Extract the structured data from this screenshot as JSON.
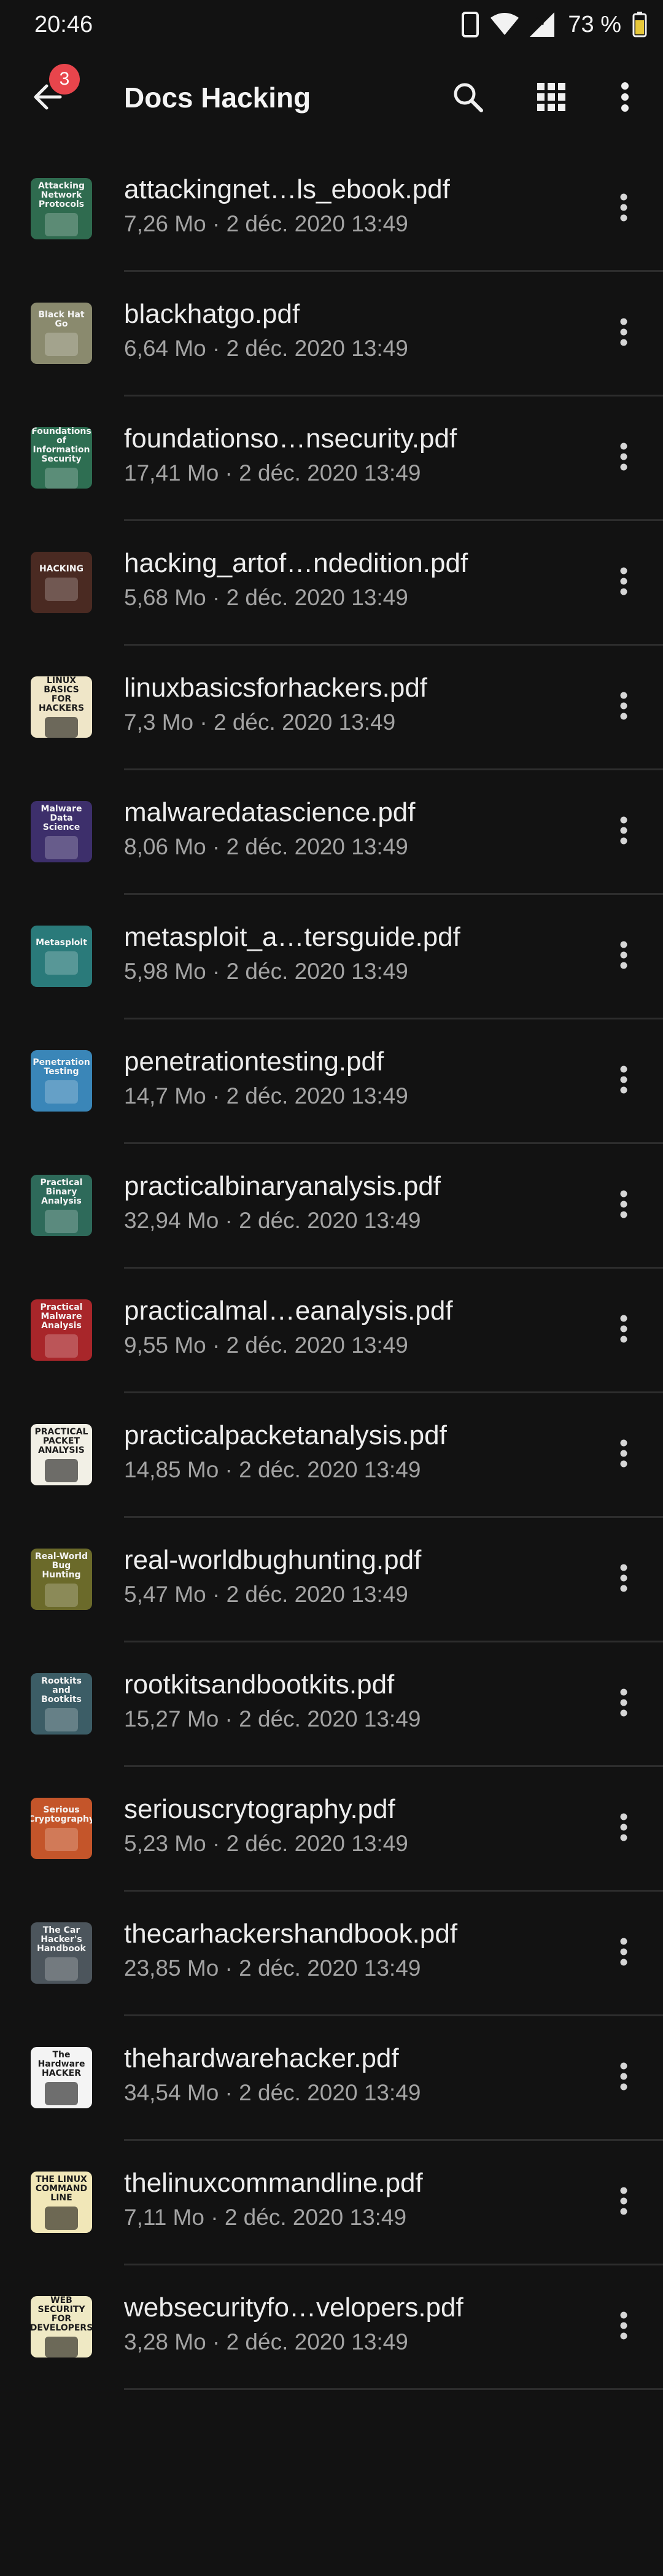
{
  "status_bar": {
    "time": "20:46",
    "battery_percent": "73 %",
    "icons": [
      "vibrate-icon",
      "wifi-icon",
      "signal-icon",
      "battery-icon"
    ]
  },
  "app_bar": {
    "title": "Docs Hacking",
    "back_badge_count": "3",
    "icons": [
      "back-arrow-icon",
      "search-icon",
      "grid-view-icon",
      "more-vert-icon"
    ]
  },
  "files": [
    {
      "name": "attackingnet…ls_ebook.pdf",
      "size": "7,26 Mo",
      "date": "2 déc. 2020 13:49",
      "meta": "7,26 Mo · 2 déc. 2020 13:49",
      "cover_text": "Attacking Network Protocols",
      "cover_color": "#2f6b4f"
    },
    {
      "name": "blackhatgo.pdf",
      "size": "6,64 Mo",
      "date": "2 déc. 2020 13:49",
      "meta": "6,64 Mo · 2 déc. 2020 13:49",
      "cover_text": "Black Hat Go",
      "cover_color": "#8a8a6e"
    },
    {
      "name": "foundationso…nsecurity.pdf",
      "size": "17,41 Mo",
      "date": "2 déc. 2020 13:49",
      "meta": "17,41 Mo · 2 déc. 2020 13:49",
      "cover_text": "Foundations of Information Security",
      "cover_color": "#2e6e52"
    },
    {
      "name": "hacking_artof…ndedition.pdf",
      "size": "5,68 Mo",
      "date": "2 déc. 2020 13:49",
      "meta": "5,68 Mo · 2 déc. 2020 13:49",
      "cover_text": "HACKING",
      "cover_color": "#4a2a22"
    },
    {
      "name": "linuxbasicsforhackers.pdf",
      "size": "7,3 Mo",
      "date": "2 déc. 2020 13:49",
      "meta": "7,3 Mo · 2 déc. 2020 13:49",
      "cover_text": "LINUX BASICS FOR HACKERS",
      "cover_color": "#efe6c8"
    },
    {
      "name": "malwaredatascience.pdf",
      "size": "8,06 Mo",
      "date": "2 déc. 2020 13:49",
      "meta": "8,06 Mo · 2 déc. 2020 13:49",
      "cover_text": "Malware Data Science",
      "cover_color": "#3d2f6b"
    },
    {
      "name": "metasploit_a…tersguide.pdf",
      "size": "5,98 Mo",
      "date": "2 déc. 2020 13:49",
      "meta": "5,98 Mo · 2 déc. 2020 13:49",
      "cover_text": "Metasploit",
      "cover_color": "#2a7a7a"
    },
    {
      "name": "penetrationtesting.pdf",
      "size": "14,7 Mo",
      "date": "2 déc. 2020 13:49",
      "meta": "14,7 Mo · 2 déc. 2020 13:49",
      "cover_text": "Penetration Testing",
      "cover_color": "#3a86b8"
    },
    {
      "name": "practicalbinaryanalysis.pdf",
      "size": "32,94 Mo",
      "date": "2 déc. 2020 13:49",
      "meta": "32,94 Mo · 2 déc. 2020 13:49",
      "cover_text": "Practical Binary Analysis",
      "cover_color": "#2e6a5a"
    },
    {
      "name": "practicalmal…eanalysis.pdf",
      "size": "9,55 Mo",
      "date": "2 déc. 2020 13:49",
      "meta": "9,55 Mo · 2 déc. 2020 13:49",
      "cover_text": "Practical Malware Analysis",
      "cover_color": "#a8262a"
    },
    {
      "name": "practicalpacketanalysis.pdf",
      "size": "14,85 Mo",
      "date": "2 déc. 2020 13:49",
      "meta": "14,85 Mo · 2 déc. 2020 13:49",
      "cover_text": "PRACTICAL PACKET ANALYSIS",
      "cover_color": "#f2f0e6"
    },
    {
      "name": "real-worldbughunting.pdf",
      "size": "5,47 Mo",
      "date": "2 déc. 2020 13:49",
      "meta": "5,47 Mo · 2 déc. 2020 13:49",
      "cover_text": "Real-World Bug Hunting",
      "cover_color": "#6b6a2a"
    },
    {
      "name": "rootkitsandbootkits.pdf",
      "size": "15,27 Mo",
      "date": "2 déc. 2020 13:49",
      "meta": "15,27 Mo · 2 déc. 2020 13:49",
      "cover_text": "Rootkits and Bootkits",
      "cover_color": "#3c5d66"
    },
    {
      "name": "seriouscrytography.pdf",
      "size": "5,23 Mo",
      "date": "2 déc. 2020 13:49",
      "meta": "5,23 Mo · 2 déc. 2020 13:49",
      "cover_text": "Serious Cryptography",
      "cover_color": "#c4552a"
    },
    {
      "name": "thecarhackershandbook.pdf",
      "size": "23,85 Mo",
      "date": "2 déc. 2020 13:49",
      "meta": "23,85 Mo · 2 déc. 2020 13:49",
      "cover_text": "The Car Hacker's Handbook",
      "cover_color": "#4c555c"
    },
    {
      "name": "thehardwarehacker.pdf",
      "size": "34,54 Mo",
      "date": "2 déc. 2020 13:49",
      "meta": "34,54 Mo · 2 déc. 2020 13:49",
      "cover_text": "The Hardware HACKER",
      "cover_color": "#f4f4f4"
    },
    {
      "name": "thelinuxcommandline.pdf",
      "size": "7,11 Mo",
      "date": "2 déc. 2020 13:49",
      "meta": "7,11 Mo · 2 déc. 2020 13:49",
      "cover_text": "THE LINUX COMMAND LINE",
      "cover_color": "#f1e7b8"
    },
    {
      "name": "websecurityfo…velopers.pdf",
      "size": "3,28 Mo",
      "date": "2 déc. 2020 13:49",
      "meta": "3,28 Mo · 2 déc. 2020 13:49",
      "cover_text": "WEB SECURITY FOR DEVELOPERS",
      "cover_color": "#efe9c4"
    }
  ]
}
